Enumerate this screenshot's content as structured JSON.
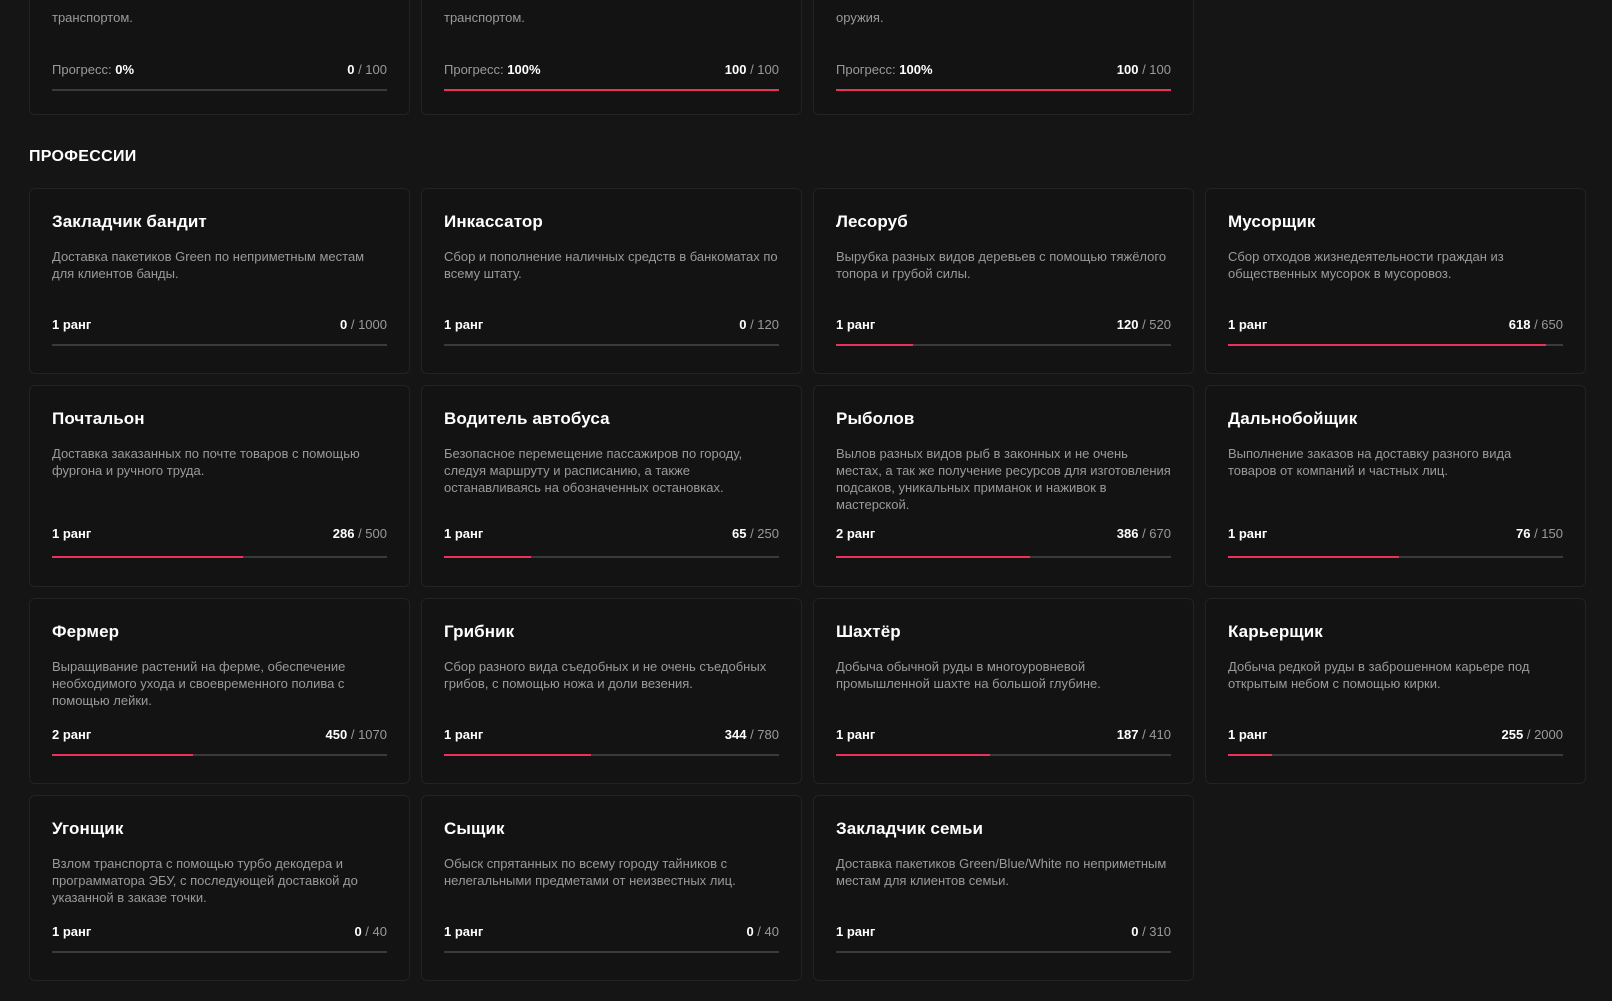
{
  "achievements": [
    {
      "desc": "транспортом.",
      "progress_label": "Прогресс:",
      "progress_value": "0%",
      "current": "0",
      "max": "100",
      "fraction": 0
    },
    {
      "desc": "транспортом.",
      "progress_label": "Прогресс:",
      "progress_value": "100%",
      "current": "100",
      "max": "100",
      "fraction": 1
    },
    {
      "desc": "оружия.",
      "progress_label": "Прогресс:",
      "progress_value": "100%",
      "current": "100",
      "max": "100",
      "fraction": 1
    }
  ],
  "section_title": "ПРОФЕССИИ",
  "professions": [
    {
      "title": "Закладчик бандит",
      "desc": "Доставка пакетиков Green по неприметным местам для клиентов банды.",
      "rank": "1 ранг",
      "current": "0",
      "max": "1000",
      "fraction": 0
    },
    {
      "title": "Инкассатор",
      "desc": "Сбор и пополнение наличных средств в банкоматах по всему штату.",
      "rank": "1 ранг",
      "current": "0",
      "max": "120",
      "fraction": 0
    },
    {
      "title": "Лесоруб",
      "desc": "Вырубка разных видов деревьев с помощью тяжёлого топора и грубой силы.",
      "rank": "1 ранг",
      "current": "120",
      "max": "520",
      "fraction": 0.23
    },
    {
      "title": "Мусорщик",
      "desc": "Сбор отходов жизнедеятельности граждан из общественных мусорок в мусоровоз.",
      "rank": "1 ранг",
      "current": "618",
      "max": "650",
      "fraction": 0.95
    },
    {
      "title": "Почтальон",
      "desc": "Доставка заказанных по почте товаров с помощью фургона и ручного труда.",
      "rank": "1 ранг",
      "current": "286",
      "max": "500",
      "fraction": 0.57
    },
    {
      "title": "Водитель автобуса",
      "desc": "Безопасное перемещение пассажиров по городу, следуя маршруту и расписанию, а также останавливаясь на обозначенных остановках.",
      "rank": "1 ранг",
      "current": "65",
      "max": "250",
      "fraction": 0.26
    },
    {
      "title": "Рыболов",
      "desc": "Вылов разных видов рыб в законных и не очень местах, а так же получение ресурсов для изготовления подсаков, уникальных приманок и наживок в мастерской.",
      "rank": "2 ранг",
      "current": "386",
      "max": "670",
      "fraction": 0.58
    },
    {
      "title": "Дальнобойщик",
      "desc": "Выполнение заказов на доставку разного вида товаров от компаний и частных лиц.",
      "rank": "1 ранг",
      "current": "76",
      "max": "150",
      "fraction": 0.51
    },
    {
      "title": "Фермер",
      "desc": "Выращивание растений на ферме, обеспечение необходимого ухода и своевременного полива с помощью лейки.",
      "rank": "2 ранг",
      "current": "450",
      "max": "1070",
      "fraction": 0.42
    },
    {
      "title": "Грибник",
      "desc": "Сбор разного вида съедобных и не очень съедобных грибов, с помощью ножа и доли везения.",
      "rank": "1 ранг",
      "current": "344",
      "max": "780",
      "fraction": 0.44
    },
    {
      "title": "Шахтёр",
      "desc": "Добыча обычной руды в многоуровневой промышленной шахте на большой глубине.",
      "rank": "1 ранг",
      "current": "187",
      "max": "410",
      "fraction": 0.46
    },
    {
      "title": "Карьерщик",
      "desc": "Добыча редкой руды в заброшенном карьере под открытым небом с помощью кирки.",
      "rank": "1 ранг",
      "current": "255",
      "max": "2000",
      "fraction": 0.13
    },
    {
      "title": "Угонщик",
      "desc": "Взлом транспорта с помощью турбо декодера и программатора ЭБУ, с последующей доставкой до указанной в заказе точки.",
      "rank": "1 ранг",
      "current": "0",
      "max": "40",
      "fraction": 0
    },
    {
      "title": "Сыщик",
      "desc": "Обыск спрятанных по всему городу тайников с нелегальными предметами от неизвестных лиц.",
      "rank": "1 ранг",
      "current": "0",
      "max": "40",
      "fraction": 0
    },
    {
      "title": "Закладчик семьи",
      "desc": "Доставка пакетиков Green/Blue/White по неприметным местам для клиентов семьи.",
      "rank": "1 ранг",
      "current": "0",
      "max": "310",
      "fraction": 0
    }
  ],
  "colors": {
    "accent": "#e8325a",
    "track": "#3a3a3a",
    "card_bg": "#131313",
    "page_bg": "#151515"
  }
}
